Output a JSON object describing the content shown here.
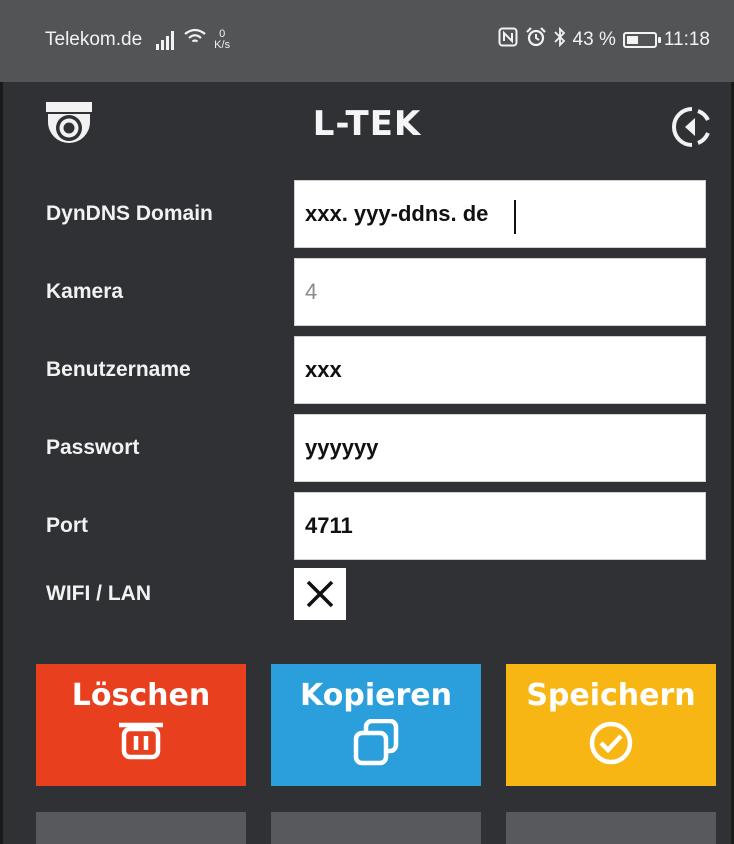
{
  "status_bar": {
    "carrier": "Telekom.de",
    "net_speed_value": "0",
    "net_speed_unit": "K/s",
    "battery_percent_text": "43 %",
    "battery_level": 0.43,
    "time": "11:18"
  },
  "header": {
    "brand": "L-TEK",
    "left_icon": "security-camera-icon",
    "right_icon": "exit-icon"
  },
  "form": {
    "fields": [
      {
        "label": "DynDNS Domain",
        "value": "xxx. yyy-ddns. de"
      },
      {
        "label": "Kamera",
        "value": "4"
      },
      {
        "label": "Benutzername",
        "value": "xxx"
      },
      {
        "label": "Passwort",
        "value": "yyyyyy"
      },
      {
        "label": "Port",
        "value": "4711"
      }
    ],
    "wifi_lan": {
      "label": "WIFI / LAN",
      "checked": true
    }
  },
  "actions": [
    {
      "label": "Löschen",
      "icon": "trash-icon",
      "color": "#e8401f"
    },
    {
      "label": "Kopieren",
      "icon": "copy-icon",
      "color": "#2b9fdc"
    },
    {
      "label": "Speichern",
      "icon": "check-circle-icon",
      "color": "#f7b614"
    }
  ],
  "colors": {
    "background": "#2f3134",
    "status_bar": "#525456",
    "secondary_button": "#57595c"
  }
}
